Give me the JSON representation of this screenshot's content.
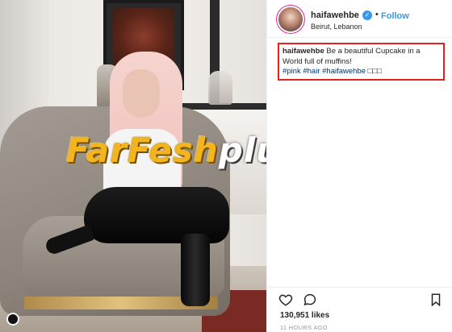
{
  "post": {
    "username": "haifawehbe",
    "follow_label": "Follow",
    "separator": "•",
    "location": "Beirut, Lebanon",
    "caption": {
      "username": "haifawehbe",
      "text": "Be a beautiful Cupcake in a World full of muffins!",
      "hashtags": [
        "#pink",
        "#hair",
        "#haifawehbe"
      ],
      "trailing": "□□□"
    },
    "likes": "130,951 likes",
    "timestamp": "11 HOURS AGO"
  },
  "watermark": {
    "main": "FarFesh",
    "suffix": "plus.com"
  },
  "icons": {
    "verified": "verified-badge-icon",
    "like": "heart-icon",
    "comment": "comment-bubble-icon",
    "save": "bookmark-icon"
  },
  "colors": {
    "accent": "#3897f0",
    "highlight_box": "#e2231a",
    "hashtag": "#003569",
    "watermark": "#f3b41d"
  }
}
